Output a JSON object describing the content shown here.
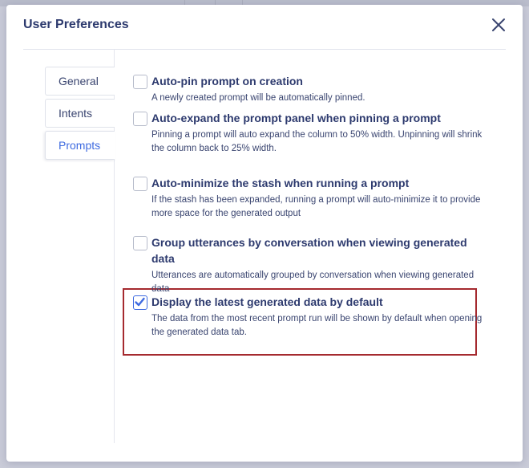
{
  "dialog": {
    "title": "User Preferences",
    "close_icon": "close-icon"
  },
  "nav": {
    "items": [
      {
        "label": "General",
        "active": false
      },
      {
        "label": "Intents",
        "active": false
      },
      {
        "label": "Prompts",
        "active": true
      }
    ]
  },
  "options": [
    {
      "title": "Auto-pin prompt on creation",
      "description": "A newly created prompt will be automatically pinned.",
      "checked": false
    },
    {
      "title": "Auto-expand the prompt panel when pinning a prompt",
      "description": "Pinning a prompt will auto expand the column to 50% width. Unpinning will shrink the column back to 25% width.",
      "checked": false
    },
    {
      "title": "Auto-minimize the stash when running a prompt",
      "description": "If the stash has been expanded, running a prompt will auto-minimize it to provide more space for the generated output",
      "checked": false
    },
    {
      "title": "Group utterances by conversation when viewing generated data",
      "description": "Utterances are automatically grouped by conversation when viewing generated data",
      "checked": false
    },
    {
      "title": "Display the latest generated data by default",
      "description": "The data from the most recent prompt run will be shown by default when opening the generated data tab.",
      "checked": true
    }
  ],
  "colors": {
    "accent": "#3f6be0",
    "title_text": "#2d3a6e",
    "highlight_border": "#a52a2f",
    "overlay": "#c9cbd8"
  }
}
